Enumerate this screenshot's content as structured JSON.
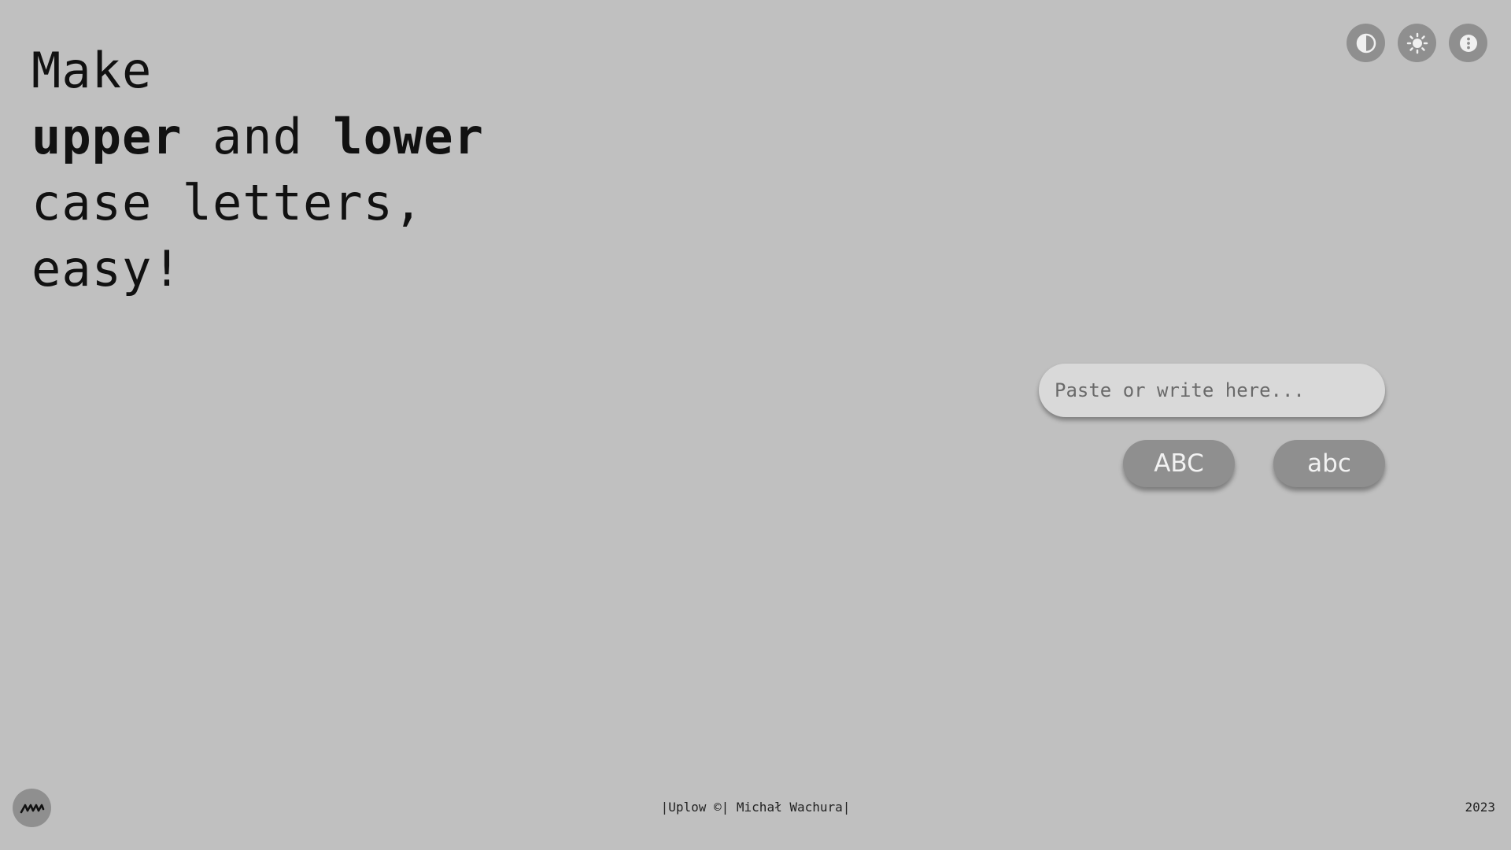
{
  "hero": {
    "line1": "Make",
    "line2_bold1": "upper",
    "line2_mid": " and ",
    "line2_bold2": "lower",
    "line3": "case letters,",
    "line4": "easy!"
  },
  "toolbar": {
    "icons": [
      "contrast-icon",
      "brightness-icon",
      "more-vertical-icon"
    ]
  },
  "input": {
    "placeholder": "Paste or write here...",
    "value": ""
  },
  "buttons": {
    "uppercase_label": "ABC",
    "lowercase_label": "abc"
  },
  "footer": {
    "credit": "|Uplow ©| Michał Wachura|",
    "year": "2023",
    "logo_icon": "mw-logo-icon"
  },
  "colors": {
    "background": "#c0c0c0",
    "button": "#8f8f8f",
    "input_bg": "#d9d9d9",
    "text": "#111111"
  }
}
